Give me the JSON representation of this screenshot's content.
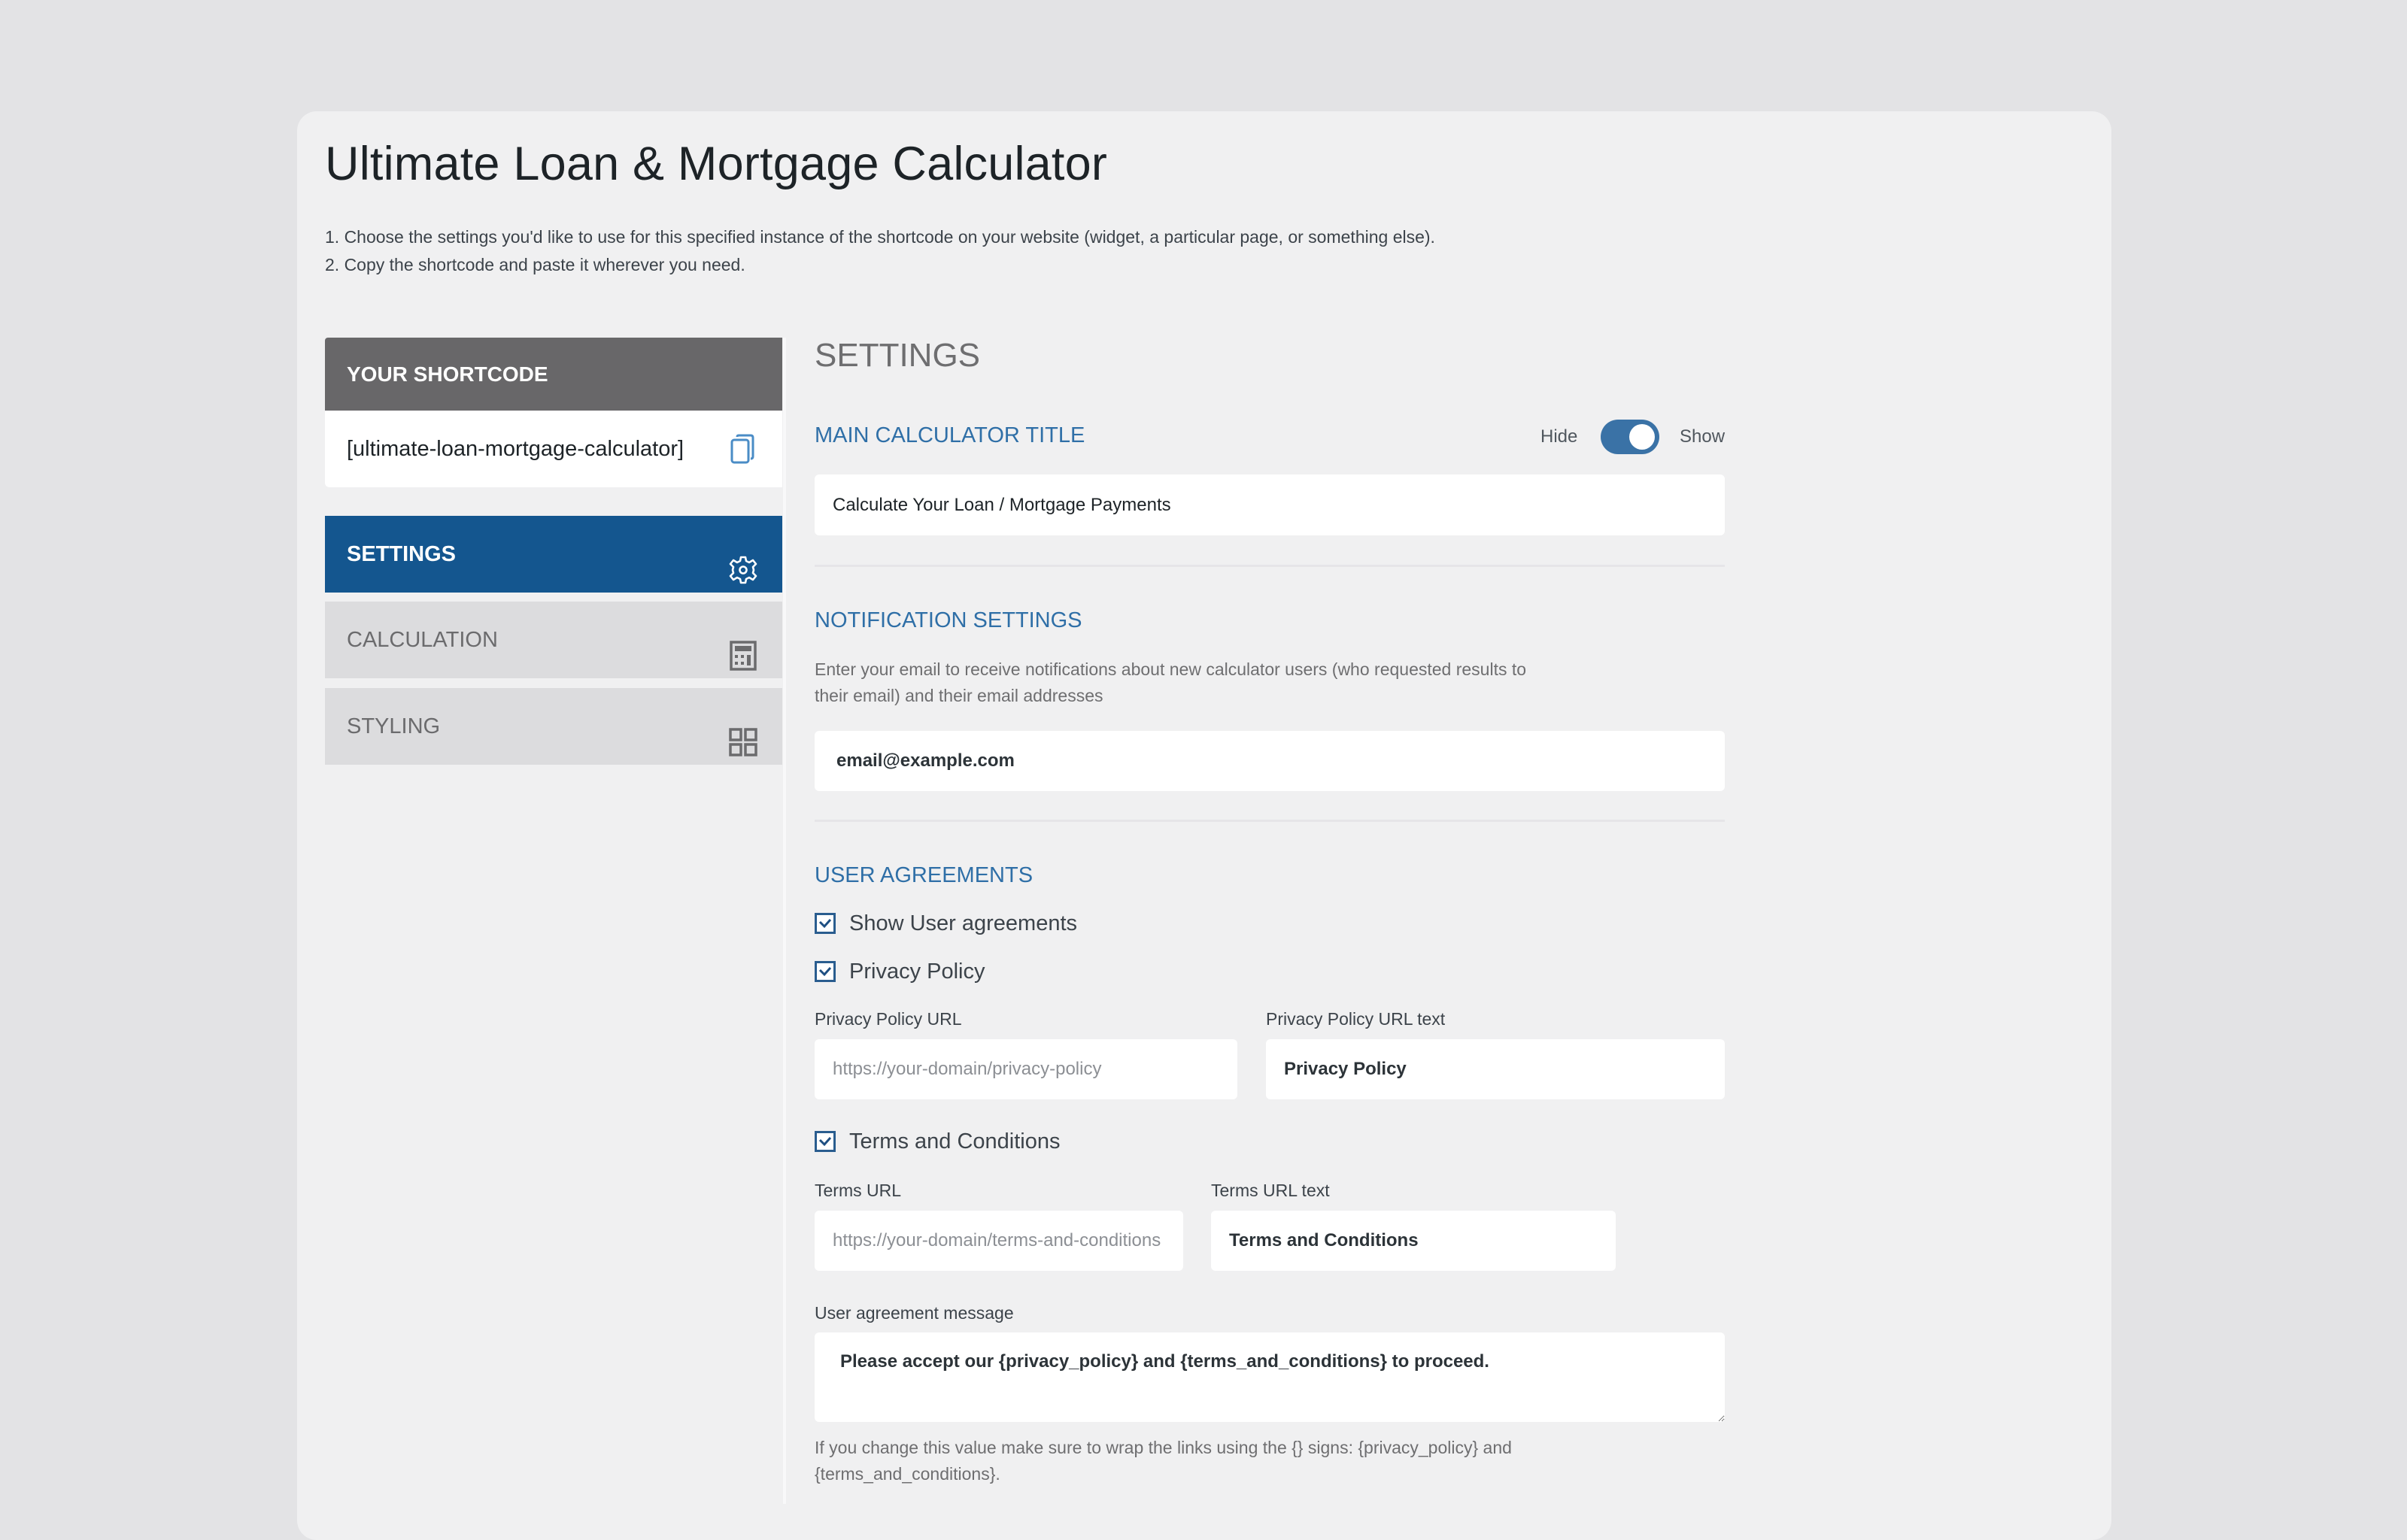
{
  "page": {
    "title": "Ultimate Loan & Mortgage Calculator",
    "instructions": [
      "1. Choose the settings you'd like to use for this specified instance of the shortcode on your website (widget, a particular page, or something else).",
      "2. Copy the shortcode and paste it wherever you need."
    ]
  },
  "sidebar": {
    "shortcode_header": "YOUR SHORTCODE",
    "shortcode_value": "[ultimate-loan-mortgage-calculator]",
    "copy_icon": "copy-icon",
    "tabs": [
      {
        "label": "SETTINGS",
        "icon": "gear-icon",
        "active": true
      },
      {
        "label": "CALCULATION",
        "icon": "calculator-icon",
        "active": false
      },
      {
        "label": "STYLING",
        "icon": "grid-icon",
        "active": false
      }
    ]
  },
  "main": {
    "heading": "SETTINGS",
    "calculator_title": {
      "heading": "MAIN CALCULATOR TITLE",
      "toggle_off_label": "Hide",
      "toggle_on_label": "Show",
      "toggle_state": "Show",
      "value": "Calculate Your Loan / Mortgage Payments"
    },
    "notification": {
      "heading": "NOTIFICATION SETTINGS",
      "description_line1": "Enter your email to receive notifications about new calculator users (who requested results to",
      "description_line2": "their email) and their email addresses",
      "email_value": "email@example.com"
    },
    "agreements": {
      "heading": "USER AGREEMENTS",
      "show_agreements": {
        "label": "Show User agreements",
        "checked": true
      },
      "privacy_policy": {
        "label": "Privacy Policy",
        "checked": true
      },
      "privacy_url_label": "Privacy Policy URL",
      "privacy_url_placeholder": "https://your-domain/privacy-policy",
      "privacy_url_text_label": "Privacy Policy URL text",
      "privacy_url_text_value": "Privacy Policy",
      "terms": {
        "label": "Terms and Conditions",
        "checked": true
      },
      "terms_url_label": "Terms URL",
      "terms_url_placeholder": "https://your-domain/terms-and-conditions",
      "terms_url_text_label": "Terms URL text",
      "terms_url_text_value": "Terms and Conditions",
      "message_label": "User agreement message",
      "message_value": "Please accept our {privacy_policy} and {terms_and_conditions} to proceed.",
      "help_line1": "If you change this value make sure to wrap the links using the {} signs: {privacy_policy} and",
      "help_line2": "{terms_and_conditions}."
    }
  },
  "colors": {
    "accent": "#14568f",
    "heading_blue": "#2f6fa7",
    "toggle_on": "#3a72a6",
    "shortcode_header_bg": "#686769",
    "tab_inactive_bg": "#dcdcde"
  }
}
